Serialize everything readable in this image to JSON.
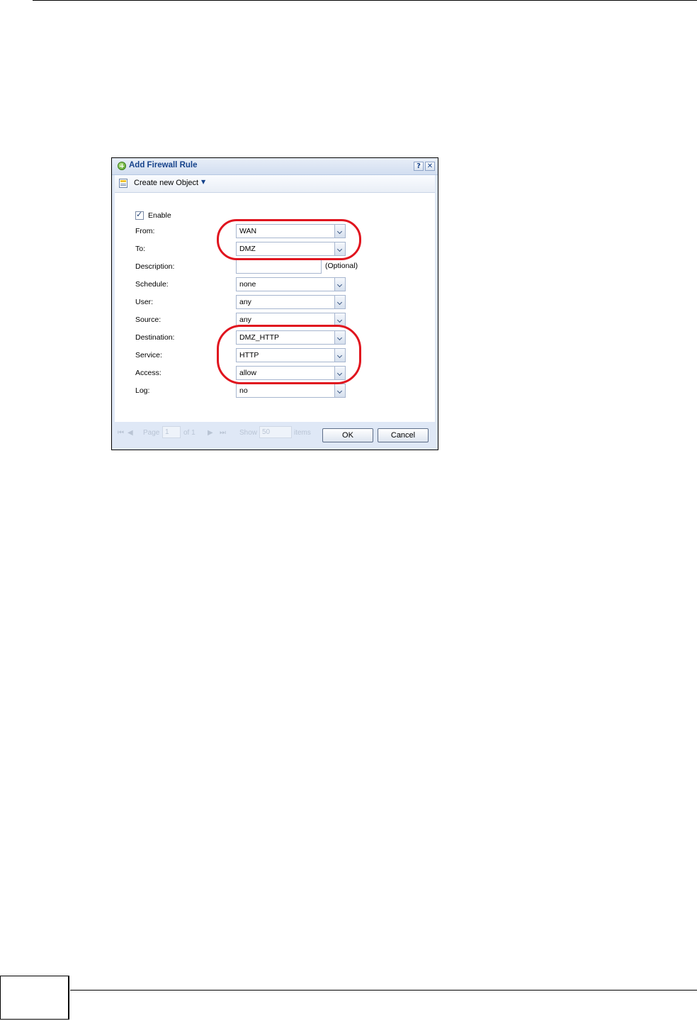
{
  "dialog": {
    "title": "Add Firewall Rule",
    "help_label": "?",
    "close_label": "✕",
    "toolbar": {
      "create_object_label": "Create new Object"
    },
    "enable": {
      "label": "Enable",
      "checked": true
    },
    "fields": {
      "from": {
        "label": "From:",
        "value": "WAN"
      },
      "to": {
        "label": "To:",
        "value": "DMZ"
      },
      "description": {
        "label": "Description:",
        "value": "",
        "hint": "(Optional)"
      },
      "schedule": {
        "label": "Schedule:",
        "value": "none"
      },
      "user": {
        "label": "User:",
        "value": "any"
      },
      "source": {
        "label": "Source:",
        "value": "any"
      },
      "destination": {
        "label": "Destination:",
        "value": "DMZ_HTTP"
      },
      "service": {
        "label": "Service:",
        "value": "HTTP"
      },
      "access": {
        "label": "Access:",
        "value": "allow"
      },
      "log": {
        "label": "Log:",
        "value": "no"
      }
    },
    "pager": {
      "page_label": "Page",
      "page_value": "1",
      "of_label": "of 1",
      "show_label": "Show",
      "show_value": "50",
      "items_label": "items"
    },
    "buttons": {
      "ok": "OK",
      "cancel": "Cancel"
    }
  },
  "colors": {
    "highlight": "#e0141e",
    "title_text": "#15428b",
    "dialog_bg": "#dfe8f6"
  }
}
